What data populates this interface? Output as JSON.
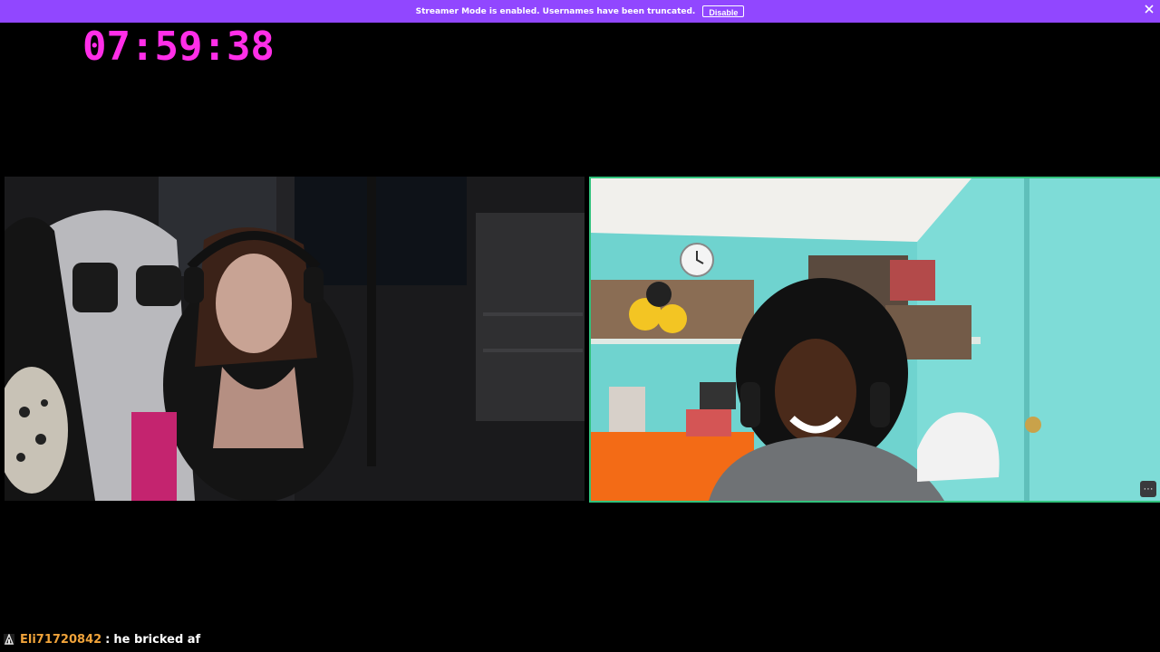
{
  "banner": {
    "message": "Streamer Mode is enabled. Usernames have been truncated.",
    "disable_label": "Disable",
    "close_icon": "close-icon",
    "bg_color": "#9147ff"
  },
  "timer": {
    "value": "07:59:38",
    "color": "#ff2ee8"
  },
  "feeds": {
    "left": {
      "description_icon": "video-feed"
    },
    "right": {
      "border_color": "#31c27c",
      "more_label": "···"
    }
  },
  "chat": {
    "username": "Eli71720842",
    "separator": ":",
    "message": "he bricked af",
    "username_color": "#f0a33a"
  }
}
